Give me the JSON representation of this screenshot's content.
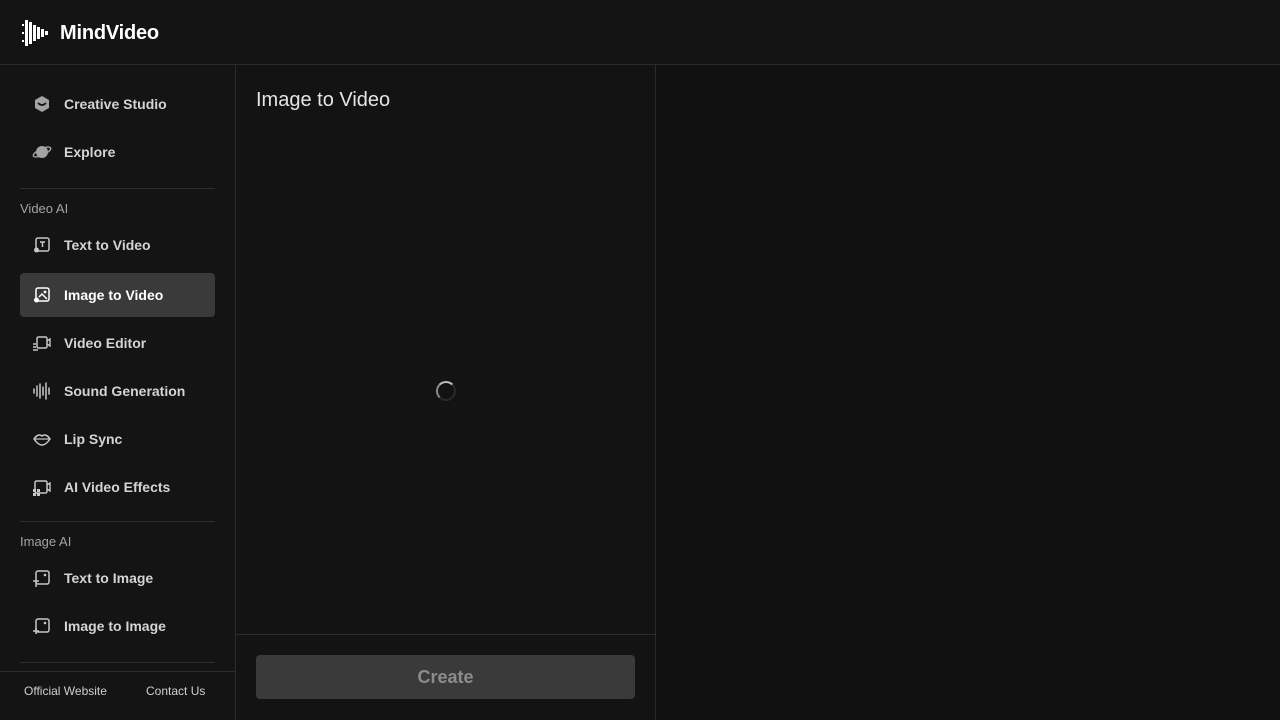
{
  "app": {
    "name": "MindVideo"
  },
  "sidebar": {
    "top_items": [
      {
        "label": "Creative Studio",
        "icon": "box-icon"
      },
      {
        "label": "Explore",
        "icon": "planet-icon"
      }
    ],
    "video_section": {
      "label": "Video AI",
      "items": [
        {
          "label": "Text to Video",
          "icon": "text-video-icon"
        },
        {
          "label": "Image to Video",
          "icon": "image-video-icon",
          "active": true
        },
        {
          "label": "Video Editor",
          "icon": "video-editor-icon"
        },
        {
          "label": "Sound Generation",
          "icon": "sound-wave-icon"
        },
        {
          "label": "Lip Sync",
          "icon": "lips-icon"
        },
        {
          "label": "AI Video Effects",
          "icon": "video-effects-icon"
        }
      ]
    },
    "image_section": {
      "label": "Image AI",
      "items": [
        {
          "label": "Text to Image",
          "icon": "text-image-icon"
        },
        {
          "label": "Image to Image",
          "icon": "image-image-icon"
        }
      ]
    },
    "footer": {
      "official_website": "Official Website",
      "contact_us": "Contact Us"
    }
  },
  "panel": {
    "title": "Image to Video",
    "create_label": "Create"
  },
  "colors": {
    "background": "#111111",
    "active_item": "#3a3a3a",
    "button_disabled": "#3a3a3a"
  }
}
